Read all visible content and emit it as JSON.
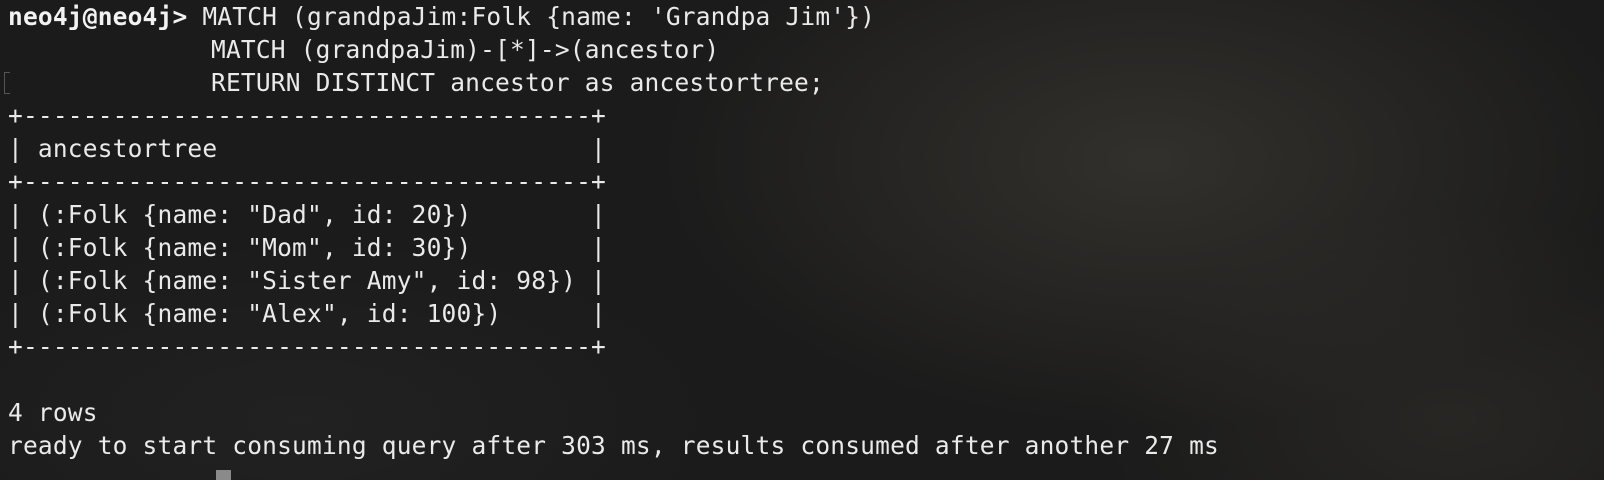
{
  "terminal": {
    "prompt": "neo4j@neo4j>",
    "query": [
      " MATCH (grandpaJim:Folk {name: 'Grandpa Jim'})",
      "MATCH (grandpaJim)-[*]->(ancestor)",
      "RETURN DISTINCT ancestor as ancestortree;"
    ],
    "table": {
      "border": "+--------------------------------------+",
      "header": "| ancestortree                         |",
      "rows": [
        "| (:Folk {name: \"Dad\", id: 20})        |",
        "| (:Folk {name: \"Mom\", id: 30})        |",
        "| (:Folk {name: \"Sister Amy\", id: 98}) |",
        "| (:Folk {name: \"Alex\", id: 100})      |"
      ]
    },
    "row_count": "4 rows",
    "timing": "ready to start consuming query after 303 ms, results consumed after another 27 ms"
  }
}
